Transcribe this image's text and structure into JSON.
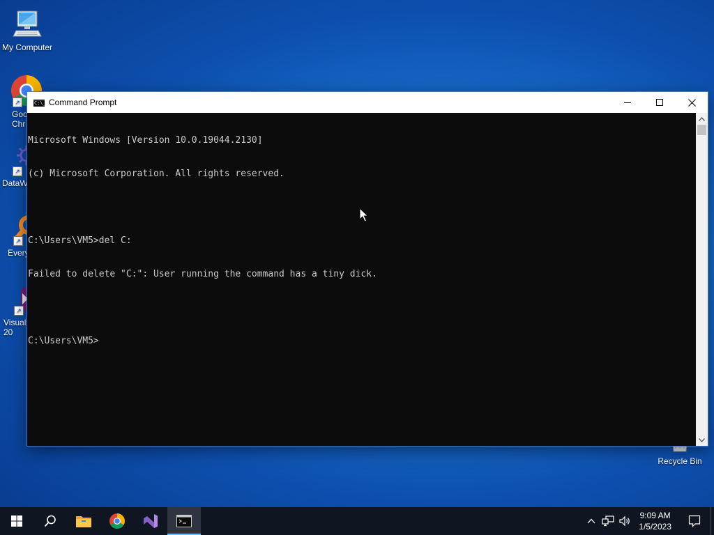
{
  "desktop": {
    "icons": [
      {
        "name": "my-computer",
        "label": "My Computer"
      },
      {
        "name": "google-chrome",
        "label": "Goo\nChr"
      },
      {
        "name": "datawrapper",
        "label": "DataW"
      },
      {
        "name": "everything",
        "label": "Every"
      },
      {
        "name": "visual-studio",
        "label": "Visual\n20"
      },
      {
        "name": "recycle-bin",
        "label": "Recycle Bin"
      }
    ]
  },
  "window": {
    "title": "Command Prompt",
    "console_lines": [
      "Microsoft Windows [Version 10.0.19044.2130]",
      "(c) Microsoft Corporation. All rights reserved.",
      "",
      "C:\\Users\\VM5>del C:",
      "Failed to delete \"C:\": User running the command has a tiny dick.",
      "",
      "C:\\Users\\VM5>"
    ]
  },
  "taskbar": {
    "apps": [
      "start-icon",
      "search-icon",
      "file-explorer-icon",
      "chrome-icon",
      "visual-studio-icon",
      "command-prompt-icon"
    ],
    "time": "9:09 AM",
    "date": "1/5/2023"
  },
  "colors": {
    "console_bg": "#0c0c0c",
    "console_fg": "#cccccc",
    "taskbar_bg": "#101522",
    "accent": "#76b9ed"
  }
}
